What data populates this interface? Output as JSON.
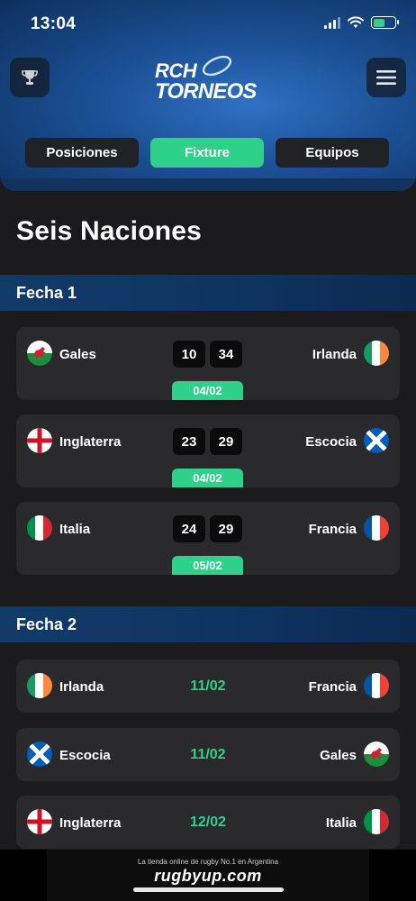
{
  "status_bar": {
    "time": "13:04"
  },
  "header": {
    "logo_line1": "RCH",
    "logo_line2": "TORNEOS",
    "tabs": [
      {
        "label": "Posiciones"
      },
      {
        "label": "Fixture"
      },
      {
        "label": "Equipos"
      }
    ],
    "active_tab": "Fixture"
  },
  "page_title": "Seis Naciones",
  "rounds": [
    {
      "label": "Fecha 1",
      "matches": [
        {
          "home": "Gales",
          "away": "Irlanda",
          "home_score": "10",
          "away_score": "34",
          "date": "04/02"
        },
        {
          "home": "Inglaterra",
          "away": "Escocia",
          "home_score": "23",
          "away_score": "29",
          "date": "04/02"
        },
        {
          "home": "Italia",
          "away": "Francia",
          "home_score": "24",
          "away_score": "29",
          "date": "05/02"
        }
      ]
    },
    {
      "label": "Fecha 2",
      "matches": [
        {
          "home": "Irlanda",
          "away": "Francia",
          "date": "11/02"
        },
        {
          "home": "Escocia",
          "away": "Gales",
          "date": "11/02"
        },
        {
          "home": "Inglaterra",
          "away": "Italia",
          "date": "12/02"
        }
      ]
    }
  ],
  "banner": {
    "line1": "La tienda online de rugby No.1 en Argentina",
    "brand": "rugbyup.com"
  },
  "colors": {
    "accent": "#2fd08a",
    "card": "#2a2a2c",
    "background": "#1b1b1d",
    "header_blue": "#1b4f93"
  }
}
